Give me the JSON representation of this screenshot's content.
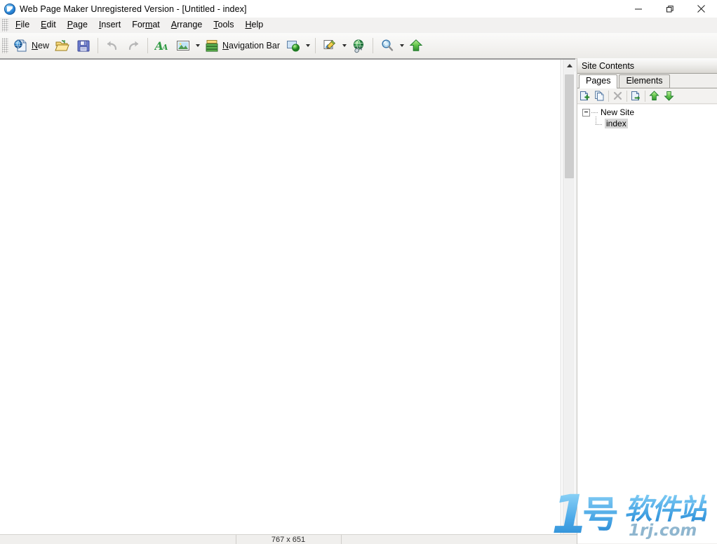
{
  "window": {
    "title": "Web Page Maker Unregistered Version - [Untitled - index]",
    "app_icon": "app-logo-icon",
    "controls": [
      {
        "name": "minimize",
        "glyph": "minimize-icon"
      },
      {
        "name": "restore",
        "glyph": "restore-icon"
      },
      {
        "name": "close",
        "glyph": "close-icon"
      }
    ]
  },
  "menubar": {
    "items": [
      {
        "label": "File",
        "mnemonic": "F"
      },
      {
        "label": "Edit",
        "mnemonic": "E"
      },
      {
        "label": "Page",
        "mnemonic": "P"
      },
      {
        "label": "Insert",
        "mnemonic": "I"
      },
      {
        "label": "Format",
        "mnemonic": "m"
      },
      {
        "label": "Arrange",
        "mnemonic": "A"
      },
      {
        "label": "Tools",
        "mnemonic": "T"
      },
      {
        "label": "Help",
        "mnemonic": "H"
      }
    ]
  },
  "toolbar": {
    "new_label": "New",
    "new_mnemonic": "N",
    "navbar_label": "Navigation Bar",
    "navbar_mnemonic": "N",
    "buttons": [
      {
        "name": "new-page-button",
        "icon": "new-page-icon",
        "label": "New"
      },
      {
        "name": "open-button",
        "icon": "open-folder-icon"
      },
      {
        "name": "save-button",
        "icon": "floppy-save-icon"
      },
      {
        "name": "undo-button",
        "icon": "undo-icon",
        "disabled": true
      },
      {
        "name": "redo-button",
        "icon": "redo-icon",
        "disabled": true
      },
      {
        "name": "insert-text-button",
        "icon": "text-aa-icon"
      },
      {
        "name": "insert-image-button",
        "icon": "image-icon",
        "has_dropdown": true
      },
      {
        "name": "navigation-bar-button",
        "icon": "navigation-bar-icon",
        "label": "Navigation Bar"
      },
      {
        "name": "insert-object-button",
        "icon": "object-shape-icon",
        "has_dropdown": true
      },
      {
        "name": "effects-button",
        "icon": "effects-pen-icon",
        "has_dropdown": true
      },
      {
        "name": "hyperlink-button",
        "icon": "globe-link-icon"
      },
      {
        "name": "preview-button",
        "icon": "magnifier-preview-icon",
        "has_dropdown": true
      },
      {
        "name": "publish-button",
        "icon": "upload-arrow-icon"
      }
    ]
  },
  "dock": {
    "title": "Site Contents",
    "tabs": [
      {
        "label": "Pages",
        "active": true
      },
      {
        "label": "Elements",
        "active": false
      }
    ],
    "toolbar_buttons": [
      {
        "name": "add-page-button",
        "icon": "add-page-icon",
        "disabled": false
      },
      {
        "name": "duplicate-page-button",
        "icon": "duplicate-page-icon",
        "disabled": false
      },
      {
        "name": "delete-page-button",
        "icon": "delete-x-icon",
        "disabled": true
      },
      {
        "name": "page-properties-button",
        "icon": "page-properties-icon",
        "disabled": false
      },
      {
        "name": "move-up-button",
        "icon": "arrow-up-icon",
        "disabled": false
      },
      {
        "name": "move-down-button",
        "icon": "arrow-down-icon",
        "disabled": false
      }
    ],
    "tree": {
      "root": {
        "label": "New Site",
        "expanded": true
      },
      "children": [
        {
          "label": "index",
          "selected": true
        }
      ]
    }
  },
  "statusbar": {
    "message": "",
    "page_size": "767 x 651",
    "extra": ""
  },
  "scrollbar": {
    "up_icon": "scroll-up-arrow-icon",
    "down_icon": "scroll-down-arrow-icon",
    "thumb_name": "vertical-scroll-thumb"
  },
  "watermark": {
    "numeral": "1",
    "character": "号",
    "brand": "软件站",
    "url": "1rj.com"
  },
  "colors": {
    "accent_blue": "#2a86d8",
    "toolbar_bg": "#f3f2f0",
    "canvas_bg": "#ffffff",
    "selection_gray": "#d7d7d7",
    "watermark_blue": "#4aa8e8"
  }
}
